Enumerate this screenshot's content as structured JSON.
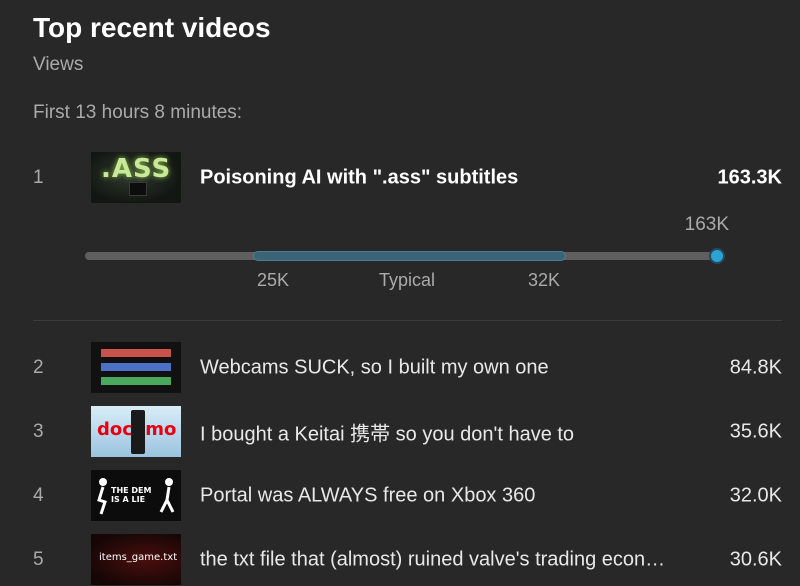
{
  "header": {
    "title": "Top recent videos",
    "metric": "Views",
    "period": "First 13 hours 8 minutes:"
  },
  "videos": [
    {
      "rank": "1",
      "title": "Poisoning AI with \".ass\" subtitles",
      "views": "163.3K",
      "thumbnail_text": ".ASS"
    },
    {
      "rank": "2",
      "title": "Webcams SUCK, so I built my own one",
      "views": "84.8K"
    },
    {
      "rank": "3",
      "title": "I bought a Keitai 携帯 so you don't have to",
      "views": "35.6K",
      "thumbnail_text": "docomo"
    },
    {
      "rank": "4",
      "title": "Portal was ALWAYS free on Xbox 360",
      "views": "32.0K",
      "thumbnail_text": "THE DEM\nIS A LIE"
    },
    {
      "rank": "5",
      "title": "the txt file that (almost) ruined valve's trading econ…",
      "views": "30.6K",
      "thumbnail_text": "items_game.txt"
    }
  ],
  "typical_range": {
    "current_label": "163K",
    "low_label": "25K",
    "high_label": "32K",
    "typical_label": "Typical",
    "low_value": 25000,
    "high_value": 32000,
    "current_value": 163000
  },
  "colors": {
    "background": "#282828",
    "accent": "#2aa4d4",
    "typical_band": "#3c6478",
    "track": "#5f5f5f"
  }
}
